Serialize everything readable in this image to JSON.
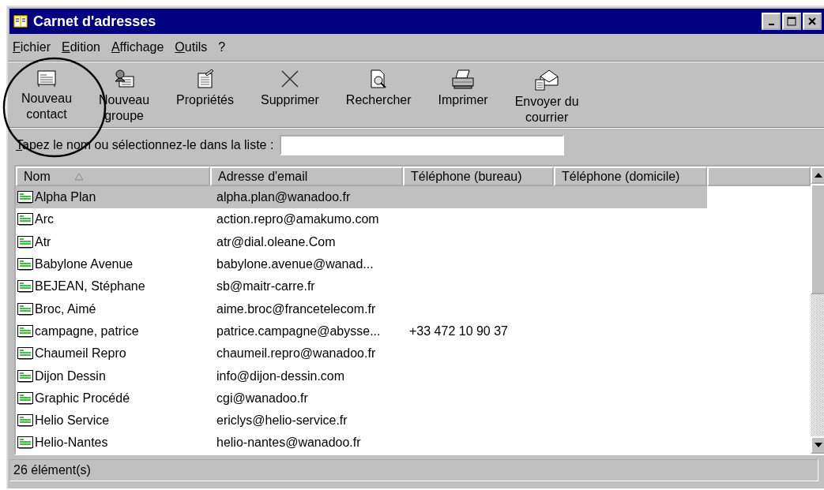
{
  "window": {
    "title": "Carnet d'adresses"
  },
  "menu": [
    "Fichier",
    "Edition",
    "Affichage",
    "Outils",
    "?"
  ],
  "toolbar": [
    {
      "kind": "contact",
      "lines": [
        "Nouveau",
        "contact"
      ],
      "circled": true
    },
    {
      "kind": "group",
      "lines": [
        "Nouveau",
        "groupe"
      ],
      "circled": false
    },
    {
      "kind": "properties",
      "lines": [
        "Propriétés"
      ],
      "circled": false
    },
    {
      "kind": "delete",
      "lines": [
        "Supprimer"
      ],
      "circled": false
    },
    {
      "kind": "find",
      "lines": [
        "Rechercher"
      ],
      "circled": false
    },
    {
      "kind": "print",
      "lines": [
        "Imprimer"
      ],
      "circled": false
    },
    {
      "kind": "mail",
      "lines": [
        "Envoyer du",
        "courrier"
      ],
      "circled": false
    }
  ],
  "search": {
    "label": "Tapez le nom ou sélectionnez-le dans la liste :"
  },
  "table": {
    "columns": [
      {
        "label": "Nom",
        "sorted": true
      },
      {
        "label": "Adresse d'email",
        "sorted": false
      },
      {
        "label": "Téléphone (bureau)",
        "sorted": false
      },
      {
        "label": "Téléphone (domicile)",
        "sorted": false
      }
    ],
    "rows": [
      {
        "name": "Alpha Plan",
        "email": "alpha.plan@wanadoo.fr",
        "phone_work": "",
        "selected": true
      },
      {
        "name": "Arc",
        "email": "action.repro@amakumo.com",
        "phone_work": "",
        "selected": false
      },
      {
        "name": "Atr",
        "email": "atr@dial.oleane.Com",
        "phone_work": "",
        "selected": false
      },
      {
        "name": "Babylone Avenue",
        "email": "babylone.avenue@wanad...",
        "phone_work": "",
        "selected": false
      },
      {
        "name": "BEJEAN, Stéphane",
        "email": "sb@maitr-carre.fr",
        "phone_work": "",
        "selected": false
      },
      {
        "name": "Broc, Aimé",
        "email": "aime.broc@francetelecom.fr",
        "phone_work": "",
        "selected": false
      },
      {
        "name": "campagne, patrice",
        "email": "patrice.campagne@abysse...",
        "phone_work": "+33 472 10 90 37",
        "selected": false
      },
      {
        "name": "Chaumeil Repro",
        "email": "chaumeil.repro@wanadoo.fr",
        "phone_work": "",
        "selected": false
      },
      {
        "name": "Dijon Dessin",
        "email": "info@dijon-dessin.com",
        "phone_work": "",
        "selected": false
      },
      {
        "name": "Graphic Procédé",
        "email": "cgi@wanadoo.fr",
        "phone_work": "",
        "selected": false
      },
      {
        "name": "Helio Service",
        "email": "ericlys@helio-service.fr",
        "phone_work": "",
        "selected": false
      },
      {
        "name": "Helio-Nantes",
        "email": "helio-nantes@wanadoo.fr",
        "phone_work": "",
        "selected": false
      }
    ]
  },
  "status_bar": "26 élément(s)"
}
